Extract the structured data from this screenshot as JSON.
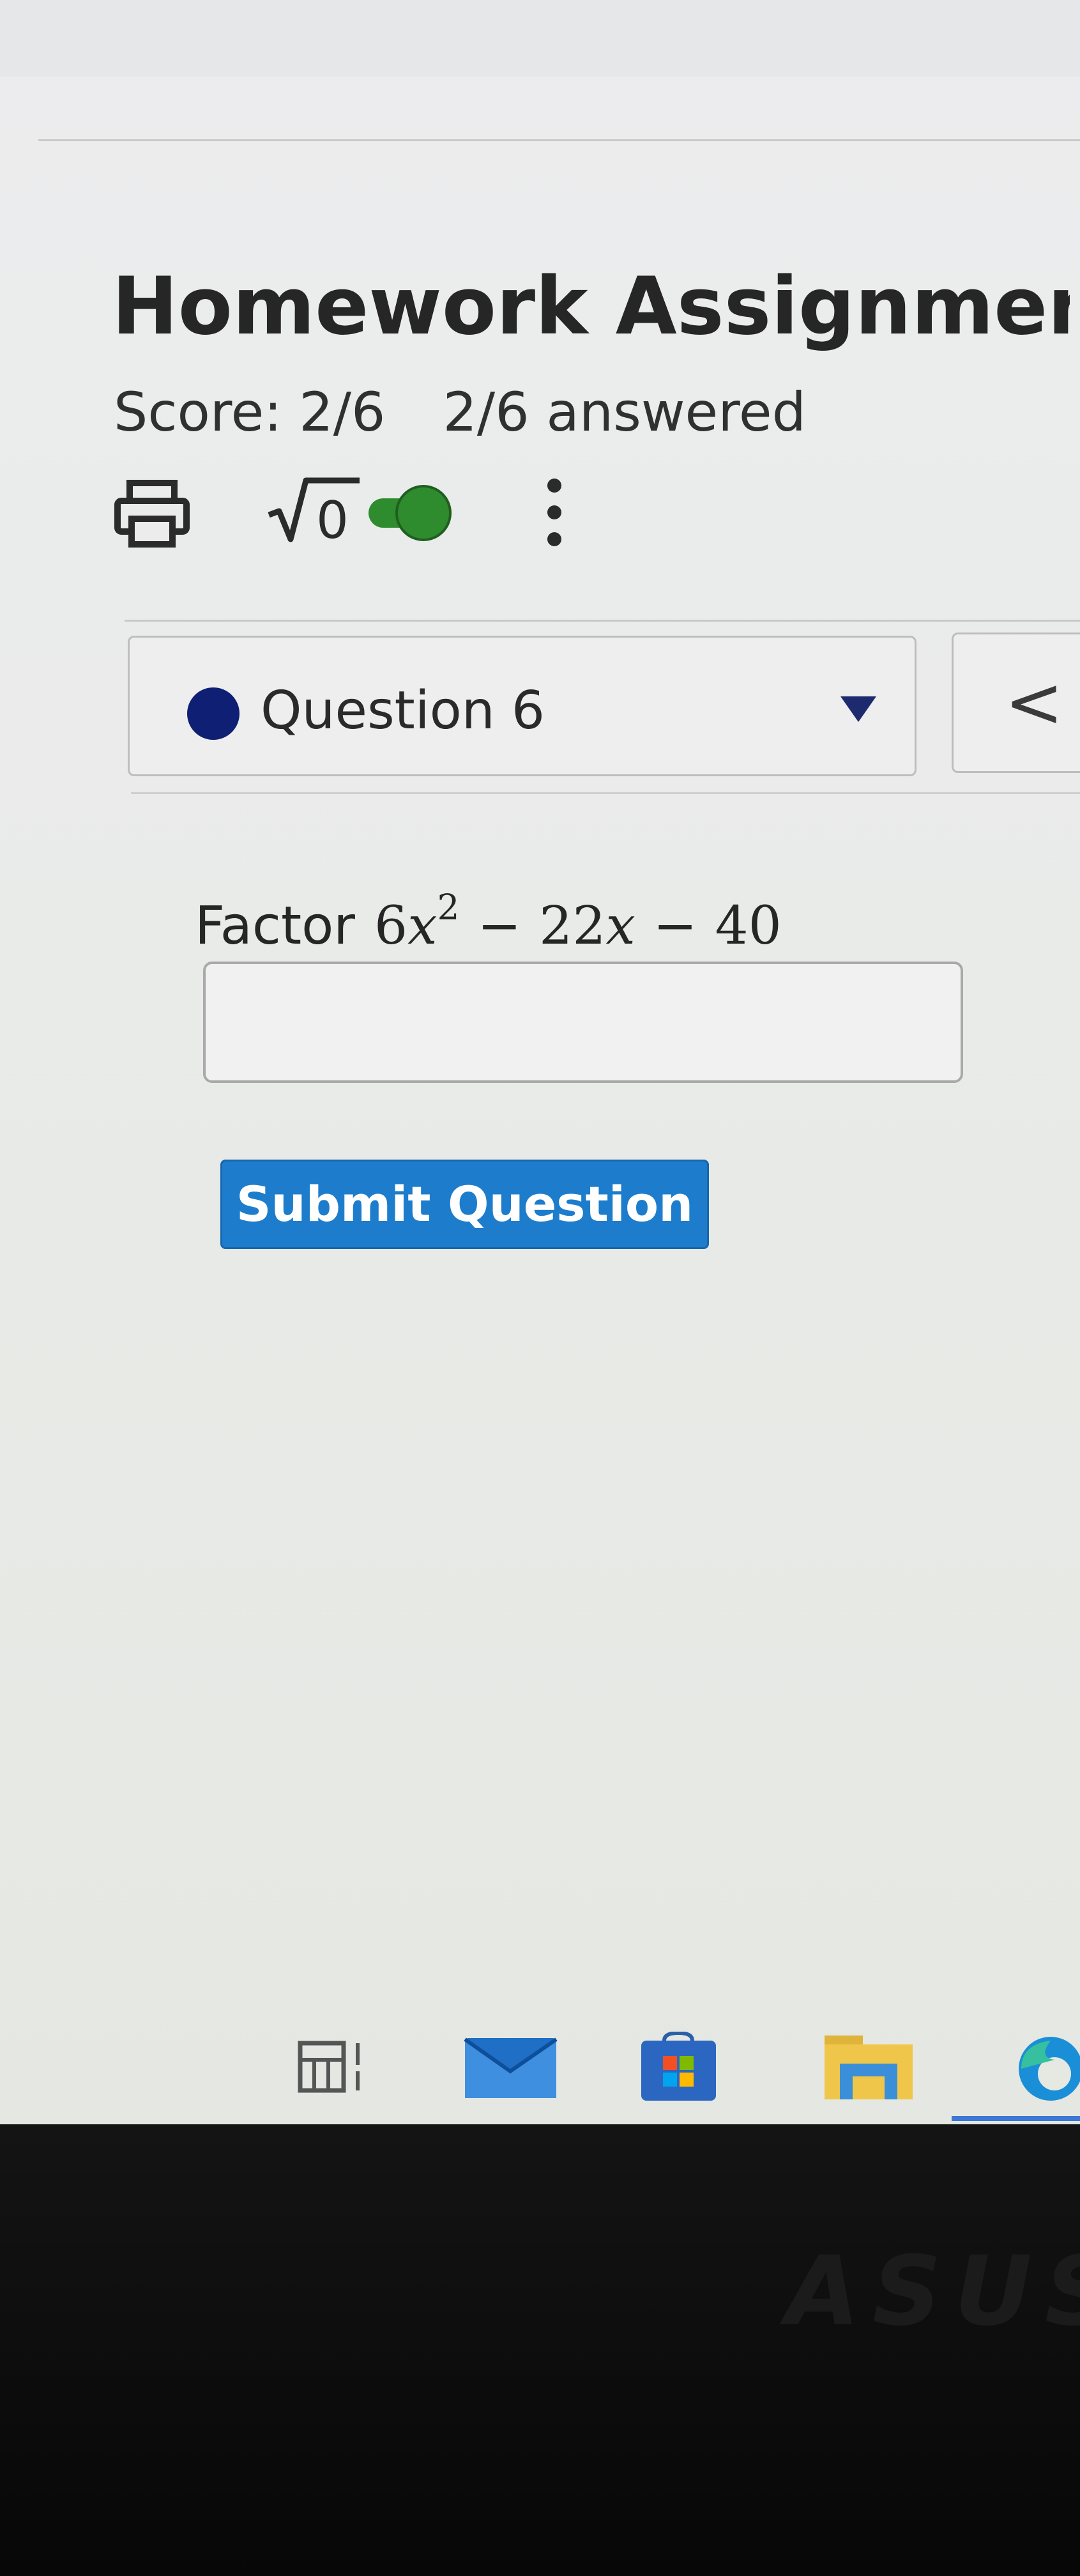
{
  "header": {
    "title": "Homework Assignment",
    "score": "Score: 2/6",
    "answered": "2/6 answered"
  },
  "toolbar": {
    "print_icon": "printer-icon",
    "math_icon": "square-root-icon",
    "math_icon_text": "√0",
    "toggle_state": "on",
    "toggle_color": "#2e8b2e",
    "more_icon": "vertical-dots-icon"
  },
  "question_nav": {
    "selected": "Question 6",
    "status_dot_color": "#0f1f73",
    "prev_symbol": "<"
  },
  "question": {
    "prompt": "Factor",
    "expression": {
      "coef1": "6",
      "var": "x",
      "exponent": "2",
      "op1": "−",
      "coef2": "22",
      "op2": "−",
      "const": "40"
    },
    "answer_value": ""
  },
  "actions": {
    "submit_label": "Submit Question"
  },
  "taskbar": {
    "icons": [
      "task-view-icon",
      "mail-icon",
      "store-icon",
      "file-explorer-icon",
      "edge-icon"
    ]
  },
  "device": {
    "brand": "ASUS"
  }
}
